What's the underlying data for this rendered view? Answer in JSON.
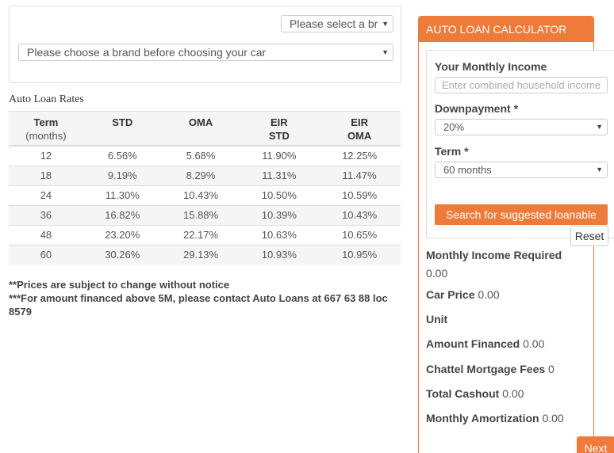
{
  "brand_filter": {
    "brand_select_value": "Please select a bra",
    "car_select_value": "Please choose a brand before choosing your car"
  },
  "rates": {
    "title": "Auto Loan Rates",
    "headers": [
      {
        "main": "Term",
        "sub": "(months)"
      },
      {
        "main": "STD",
        "sub": ""
      },
      {
        "main": "OMA",
        "sub": ""
      },
      {
        "main": "EIR",
        "sub": "STD"
      },
      {
        "main": "EIR",
        "sub": "OMA"
      }
    ],
    "rows": [
      [
        "12",
        "6.56%",
        "5.68%",
        "11.90%",
        "12.25%"
      ],
      [
        "18",
        "9.19%",
        "8.29%",
        "11.31%",
        "11.47%"
      ],
      [
        "24",
        "11.30%",
        "10.43%",
        "10.50%",
        "10.59%"
      ],
      [
        "36",
        "16.82%",
        "15.88%",
        "10.39%",
        "10.43%"
      ],
      [
        "48",
        "23.20%",
        "22.17%",
        "10.63%",
        "10.65%"
      ],
      [
        "60",
        "30.26%",
        "29.13%",
        "10.93%",
        "10.95%"
      ]
    ]
  },
  "notes": {
    "line1": "**Prices are subject to change without notice",
    "line2": "***For amount financed above 5M, please contact Auto Loans at 667 63 88 loc 8579"
  },
  "calculator": {
    "title": "AUTO LOAN CALCULATOR",
    "income_label": "Your Monthly Income",
    "income_placeholder": "Enter combined household income",
    "income_value": "",
    "downpayment_label": "Downpayment *",
    "downpayment_value": "20%",
    "term_label": "Term *",
    "term_value": "60 months",
    "search_button": "Search for suggested loanable cars",
    "reset_button": "Reset",
    "results": {
      "monthly_income_required_label": "Monthly Income Required",
      "monthly_income_required_value": "0.00",
      "car_price_label": "Car Price",
      "car_price_value": "0.00",
      "unit_label": "Unit",
      "unit_value": "",
      "amount_financed_label": "Amount Financed",
      "amount_financed_value": "0.00",
      "chattel_label": "Chattel Mortgage Fees",
      "chattel_value": "0",
      "total_cashout_label": "Total Cashout",
      "total_cashout_value": "0.00",
      "monthly_amortization_label": "Monthly Amortization",
      "monthly_amortization_value": "0.00"
    },
    "next_button": "Next"
  },
  "colors": {
    "accent": "#ef7b3a"
  }
}
